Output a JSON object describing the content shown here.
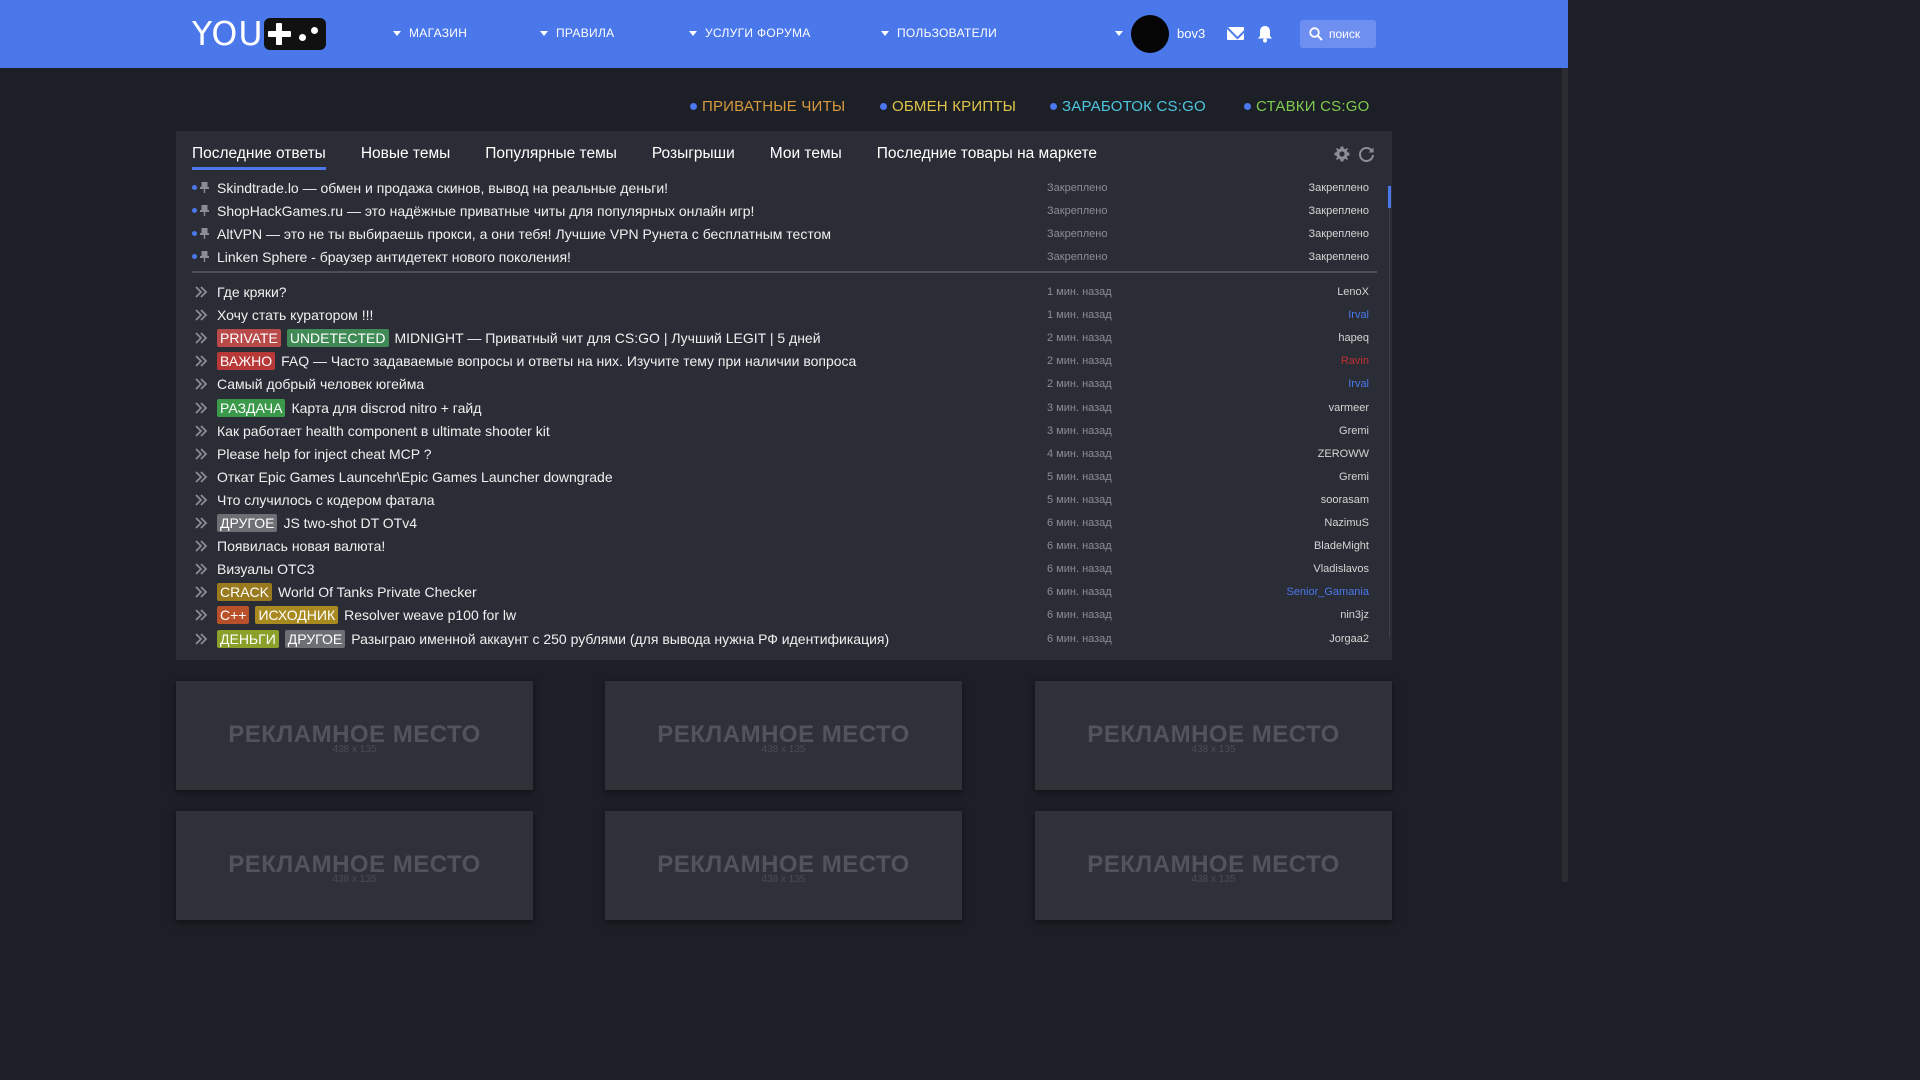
{
  "header": {
    "logo_text": "YOU",
    "nav": [
      {
        "label": "МАГАЗИН"
      },
      {
        "label": "ПРАВИЛА"
      },
      {
        "label": "УСЛУГИ ФОРУМА"
      },
      {
        "label": "ПОЛЬЗОВАТЕЛИ"
      }
    ],
    "username": "bov3",
    "search_label": "поиск",
    "accent_color": "#4a78eb"
  },
  "promo_links": [
    {
      "label": "ПРИВАТНЫЕ ЧИТЫ",
      "color": "#d79a3e"
    },
    {
      "label": "ОБМЕН КРИПТЫ",
      "color": "#e0c449"
    },
    {
      "label": "ЗАРАБОТОК CS:GO",
      "color": "#4ec6e0"
    },
    {
      "label": "СТАВКИ CS:GO",
      "color": "#7ecb4f"
    }
  ],
  "tabs": [
    {
      "label": "Последние ответы",
      "active": true
    },
    {
      "label": "Новые темы"
    },
    {
      "label": "Популярные темы"
    },
    {
      "label": "Розыгрыши"
    },
    {
      "label": "Мои темы"
    },
    {
      "label": "Последние товары на маркете"
    }
  ],
  "pinned": [
    {
      "title": "Skindtrade.lo — обмен и продажа скинов, вывод на реальные деньги!",
      "time": "Закреплено",
      "author": "Закреплено"
    },
    {
      "title": "ShopHackGames.ru — это надёжные приватные читы для популярных онлайн игр!",
      "time": "Закреплено",
      "author": "Закреплено"
    },
    {
      "title": "AltVPN — это не ты выбираешь прокси, а они тебя! Лучшие VPN Рунета с бесплатным тестом",
      "time": "Закреплено",
      "author": "Закреплено"
    },
    {
      "title": "Linken Sphere - браузер антидетект нового поколения!",
      "time": "Закреплено",
      "author": "Закреплено"
    }
  ],
  "threads": [
    {
      "badges": [],
      "title": "Где кряки?",
      "time": "1 мин. назад",
      "author": "LenoX",
      "author_color": "#d4d4d4"
    },
    {
      "badges": [],
      "title": "Хочу стать куратором !!!",
      "time": "1 мин. назад",
      "author": "Irval",
      "author_color": "#4a78eb"
    },
    {
      "badges": [
        {
          "text": "PRIVATE",
          "color": "#b84a4a"
        },
        {
          "text": "UNDETECTED",
          "color": "#3f8a55"
        }
      ],
      "title": "MIDNIGHT — Приватный чит для CS:GO | Лучший LEGIT | 5 дней",
      "time": "2 мин. назад",
      "author": "hapeq",
      "author_color": "#d4d4d4"
    },
    {
      "badges": [
        {
          "text": "ВАЖНО",
          "color": "#b83838"
        }
      ],
      "title": "FAQ — Часто задаваемые вопросы и ответы на них. Изучите тему при наличии вопроса",
      "time": "2 мин. назад",
      "author": "Ravin",
      "author_color": "#c0302f"
    },
    {
      "badges": [],
      "title": "Самый добрый человек югейма",
      "time": "2 мин. назад",
      "author": "Irval",
      "author_color": "#4a78eb"
    },
    {
      "badges": [
        {
          "text": "РАЗДАЧА",
          "color": "#3a9a4a"
        }
      ],
      "title": "Карта для discrod nitro + гайд",
      "time": "3 мин. назад",
      "author": "varmeer",
      "author_color": "#d4d4d4"
    },
    {
      "badges": [],
      "title": "Как работает health component в ultimate shooter kit",
      "time": "3 мин. назад",
      "author": "Gremi",
      "author_color": "#d4d4d4"
    },
    {
      "badges": [],
      "title": "Please help for inject cheat MCP ?",
      "time": "4 мин. назад",
      "author": "ZEROWW",
      "author_color": "#d4d4d4"
    },
    {
      "badges": [],
      "title": "Откат Epic Games Launcehr\\Epic Games Launcher downgrade",
      "time": "5 мин. назад",
      "author": "Gremi",
      "author_color": "#d4d4d4"
    },
    {
      "badges": [],
      "title": "Что случилось с кодером фатала",
      "time": "5 мин. назад",
      "author": "soorasam",
      "author_color": "#d4d4d4"
    },
    {
      "badges": [
        {
          "text": "ДРУГОЕ",
          "color": "#6d6f75"
        }
      ],
      "title": "JS two-shot DT OTv4",
      "time": "6 мин. назад",
      "author": "NazimuS",
      "author_color": "#d4d4d4"
    },
    {
      "badges": [],
      "title": "Появилась новая валюта!",
      "time": "6 мин. назад",
      "author": "BladeMight",
      "author_color": "#d4d4d4"
    },
    {
      "badges": [],
      "title": "Визуалы OTC3",
      "time": "6 мин. назад",
      "author": "Vladislavos",
      "author_color": "#d4d4d4"
    },
    {
      "badges": [
        {
          "text": "CRACK",
          "color": "#9a7a1e"
        }
      ],
      "title": "World Of Tanks Private Checker",
      "time": "6 мин. назад",
      "author": "Senior_Gamania",
      "author_color": "#4a78eb"
    },
    {
      "badges": [
        {
          "text": "C++",
          "color": "#b8502a"
        },
        {
          "text": "ИСХОДНИК",
          "color": "#a88a20"
        }
      ],
      "title": "Resolver weave p100 for lw",
      "time": "6 мин. назад",
      "author": "nin3jz",
      "author_color": "#d4d4d4"
    },
    {
      "badges": [
        {
          "text": "ДЕНЬГИ",
          "color": "#8aa02a"
        },
        {
          "text": "ДРУГОЕ",
          "color": "#6d6f75"
        }
      ],
      "title": "Разыграю именной аккаунт с 250 рублями (для вывода нужна РФ идентификация)",
      "time": "6 мин. назад",
      "author": "Jorgaa2",
      "author_color": "#d4d4d4"
    }
  ],
  "ads": [
    {
      "title": "РЕКЛАМНОЕ МЕСТО",
      "size": "438 x 135"
    },
    {
      "title": "РЕКЛАМНОЕ МЕСТО",
      "size": "438 x 135"
    },
    {
      "title": "РЕКЛАМНОЕ МЕСТО",
      "size": "438 x 135"
    },
    {
      "title": "РЕКЛАМНОЕ МЕСТО",
      "size": "438 x 135"
    },
    {
      "title": "РЕКЛАМНОЕ МЕСТО",
      "size": "438 x 135"
    },
    {
      "title": "РЕКЛАМНОЕ МЕСТО",
      "size": "438 x 135"
    }
  ]
}
